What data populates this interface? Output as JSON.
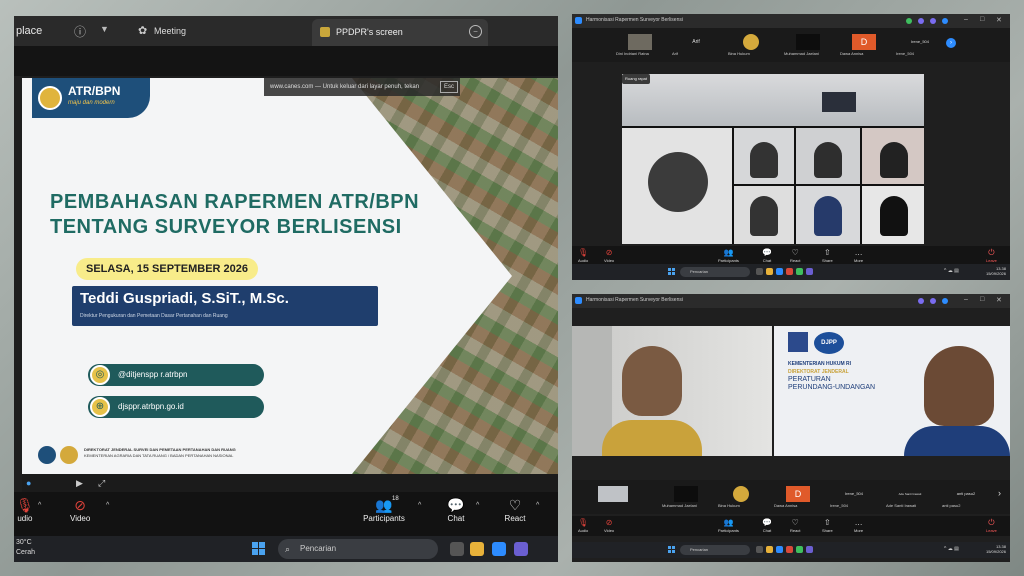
{
  "main_window": {
    "titlebar": {
      "left_text": "place",
      "meeting_label": "Meeting",
      "screen_tab_label": "PPDPR's screen"
    },
    "share_notice": {
      "text": "www.canes.com — Untuk keluar dari layar penuh, tekan",
      "key": "Esc"
    },
    "slide": {
      "logo_title": "ATR/BPN",
      "logo_tagline": "maju dan modern",
      "title_line1": "PEMBAHASAN RAPERMEN ATR/BPN",
      "title_line2": "TENTANG SURVEYOR BERLISENSI",
      "date": "SELASA, 15 SEPTEMBER 2026",
      "speaker_name": "Teddi Guspriadi, S.SiT., M.Sc.",
      "speaker_role": "Direktur Pengukuran dan Pemetaan Dasar Pertanahan dan Ruang",
      "social_instagram": "@ditjenspp r.atrbpn",
      "social_web": "djsppr.atrbpn.go.id",
      "footer_line1": "DIREKTORAT JENDERAL SURVEI DAN PEMETAAN PERTANAHAN DAN RUANG",
      "footer_line2": "KEMENTERIAN AGRARIA DAN TATA RUANG / BADAN PERTANAHAN NASIONAL"
    },
    "slide_progress": 0.0,
    "controls": {
      "audio_label": "udio",
      "video_label": "Video",
      "participants_label": "Participants",
      "participants_count": "18",
      "chat_label": "Chat",
      "react_label": "React"
    },
    "taskbar": {
      "weather_temp": "30°C",
      "weather_desc": "Cerah",
      "search_placeholder": "Pencarian"
    }
  },
  "top_right_window": {
    "title": "Harmonisasi Rapermen Surveyor Berlisensi",
    "thumbnails": [
      {
        "name": "Dini Indriani Ratna"
      },
      {
        "name": "Arif"
      },
      {
        "name": "Bina Hukum"
      },
      {
        "name": "Muhammad Jaelani"
      },
      {
        "name": "Dawa Annisa"
      },
      {
        "name": "Irene_504"
      }
    ],
    "thumb_top_names": [
      "",
      "Arif",
      "",
      "",
      "D",
      "Irene_504"
    ],
    "speaker_tag": "Ruang rapat",
    "controls": {
      "audio": "Audio",
      "video": "Video",
      "participants": "Participants",
      "chat": "Chat",
      "react": "React",
      "share": "Share",
      "more": "More",
      "leave": "Leave"
    },
    "taskbar": {
      "search": "Pencarian",
      "time": "13.38",
      "date": "15/09/2026"
    }
  },
  "bottom_right_window": {
    "title": "Harmonisasi Rapermen Surveyor Berlisensi",
    "slide_org_line1": "KEMENTERIAN HUKUM RI",
    "slide_org_line2": "DIREKTORAT JENDERAL",
    "slide_org_line3": "PERATURAN",
    "slide_org_line4": "PERUNDANG-UNDANGAN",
    "slide_logo_text": "DJPP",
    "thumbnails": [
      {
        "name": "Muhammad Jaelani"
      },
      {
        "name": "Bina Hukum"
      },
      {
        "name": "Dawa Annisa"
      },
      {
        "name": "Irene_504"
      },
      {
        "name": "Ade Santi Irawati"
      },
      {
        "name": "anti pasu2"
      }
    ],
    "thumb_top_names": [
      "",
      "",
      "D",
      "Irene_504",
      "Ade Santi Irawati",
      "anti pasu2"
    ],
    "controls": {
      "audio": "Audio",
      "video": "Video",
      "participants": "Participants",
      "chat": "Chat",
      "react": "React",
      "share": "Share",
      "more": "More",
      "leave": "Leave"
    },
    "taskbar": {
      "search": "Pencarian",
      "time": "13.38",
      "date": "15/09/2026"
    }
  },
  "colors": {
    "zoom_blue": "#2d8cff",
    "slide_title_teal": "#1f6b63",
    "speaker_box_navy": "#1f3e6d",
    "date_pill_yellow": "#f8ec8a",
    "video_off_red": "#e0423a"
  },
  "icons": {
    "info": "info-icon",
    "chevron": "chevron-down-icon",
    "meeting": "meeting-icon",
    "close": "close-icon",
    "mic_off": "microphone-off-icon",
    "video_off": "video-off-icon",
    "participants": "participants-icon",
    "chat": "chat-icon",
    "react": "heart-icon",
    "search": "search-icon",
    "windows": "windows-start-icon"
  }
}
